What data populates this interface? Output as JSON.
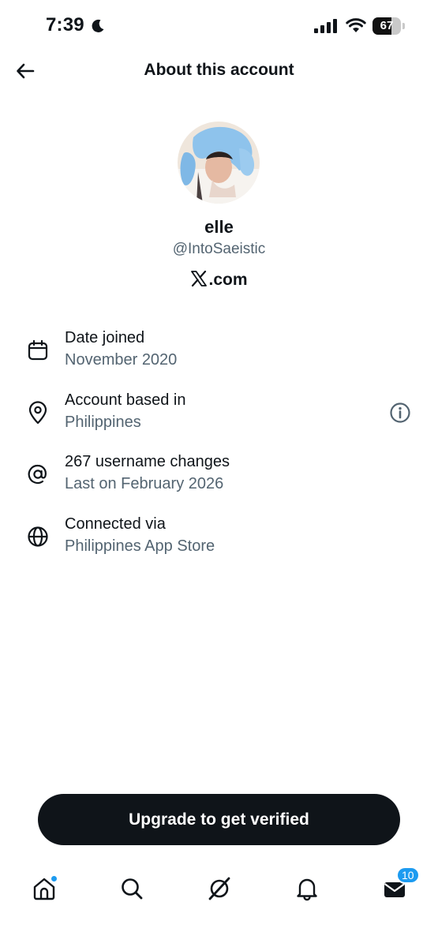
{
  "status_bar": {
    "time": "7:39",
    "battery_level": "67",
    "battery_fraction": 0.67,
    "icons": [
      "moon-icon",
      "signal-icon",
      "wifi-icon",
      "battery-icon"
    ]
  },
  "header": {
    "title": "About this account",
    "back_icon": "arrow-left-icon"
  },
  "profile": {
    "display_name": "elle",
    "handle": "@IntoSaeistic",
    "source_suffix": ".com",
    "source_logo": "x-logo-icon"
  },
  "info_rows": [
    {
      "icon": "calendar-icon",
      "title": "Date joined",
      "value": "November 2020"
    },
    {
      "icon": "location-pin-icon",
      "title": "Account based in",
      "value": "Philippines",
      "trailing_icon": "info-icon"
    },
    {
      "icon": "at-sign-icon",
      "title": "267 username changes",
      "value": "Last on February 2026"
    },
    {
      "icon": "globe-icon",
      "title": "Connected via",
      "value": "Philippines App Store"
    }
  ],
  "upgrade": {
    "label": "Upgrade to get verified"
  },
  "tab_bar": {
    "tabs": [
      {
        "name": "home",
        "icon": "home-icon",
        "has_dot": true
      },
      {
        "name": "search",
        "icon": "search-icon"
      },
      {
        "name": "grok",
        "icon": "grok-icon"
      },
      {
        "name": "notifications",
        "icon": "bell-icon"
      },
      {
        "name": "messages",
        "icon": "mail-icon",
        "badge": "10"
      }
    ]
  },
  "colors": {
    "text_primary": "#0f1419",
    "text_secondary": "#536471",
    "accent_blue": "#1d9bf0",
    "button_dark": "#0f1419",
    "background": "#ffffff"
  }
}
